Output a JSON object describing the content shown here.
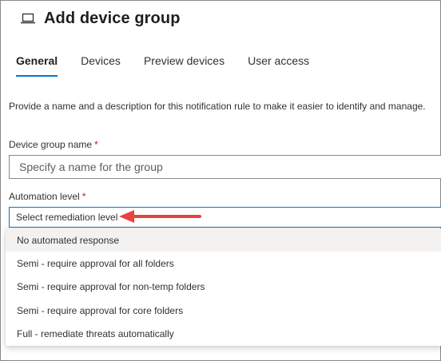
{
  "page": {
    "title": "Add device group",
    "icon": "laptop-icon"
  },
  "tabs": [
    {
      "label": "General",
      "active": true
    },
    {
      "label": "Devices",
      "active": false
    },
    {
      "label": "Preview devices",
      "active": false
    },
    {
      "label": "User access",
      "active": false
    }
  ],
  "form": {
    "description": "Provide a name and a description for this notification rule to make it easier to identify and manage.",
    "name_field": {
      "label": "Device group name",
      "required_mark": "*",
      "value": "",
      "placeholder": "Specify a name for the group"
    },
    "automation_field": {
      "label": "Automation level",
      "required_mark": "*",
      "placeholder": "Select remediation level",
      "options": [
        "No automated response",
        "Semi - require approval for all folders",
        "Semi - require approval for non-temp folders",
        "Semi - require approval for core folders",
        "Full - remediate threats automatically"
      ]
    }
  },
  "colors": {
    "accent": "#0078d4",
    "required": "#a4262c",
    "annotation_arrow": "#e8423f"
  }
}
